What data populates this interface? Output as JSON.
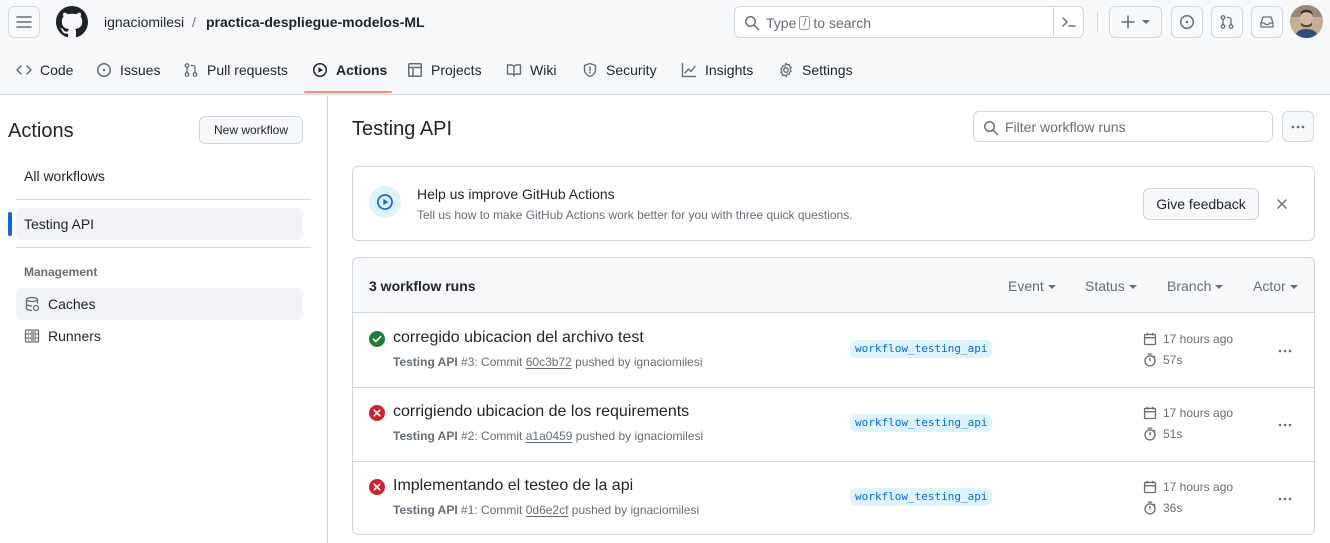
{
  "header": {
    "owner": "ignaciomilesi",
    "separator": "/",
    "repo": "practica-despliegue-modelos-ML",
    "search": {
      "prefix": "Type",
      "key": "/",
      "suffix": "to search"
    }
  },
  "repo_nav": {
    "tabs": [
      {
        "label": "Code",
        "icon": "code-icon"
      },
      {
        "label": "Issues",
        "icon": "issue-opened-icon"
      },
      {
        "label": "Pull requests",
        "icon": "git-pull-request-icon"
      },
      {
        "label": "Actions",
        "icon": "play-icon",
        "selected": true
      },
      {
        "label": "Projects",
        "icon": "table-icon"
      },
      {
        "label": "Wiki",
        "icon": "book-icon"
      },
      {
        "label": "Security",
        "icon": "shield-icon"
      },
      {
        "label": "Insights",
        "icon": "graph-icon"
      },
      {
        "label": "Settings",
        "icon": "gear-icon"
      }
    ]
  },
  "sidebar": {
    "title": "Actions",
    "new_workflow": "New workflow",
    "all_workflows": "All workflows",
    "workflows": [
      {
        "label": "Testing API",
        "active": true
      }
    ],
    "management_heading": "Management",
    "management": [
      {
        "label": "Caches",
        "icon": "database-icon"
      },
      {
        "label": "Runners",
        "icon": "server-icon"
      }
    ]
  },
  "main": {
    "title": "Testing API",
    "filter_placeholder": "Filter workflow runs",
    "banner": {
      "title": "Help us improve GitHub Actions",
      "subtitle": "Tell us how to make GitHub Actions work better for you with three quick questions.",
      "button": "Give feedback"
    },
    "runs_count": "3 workflow runs",
    "filters": [
      "Event",
      "Status",
      "Branch",
      "Actor"
    ],
    "runs": [
      {
        "status": "success",
        "title": "corregido ubicacion del archivo test",
        "workflow": "Testing API",
        "number": "#3",
        "commit_label": ": Commit",
        "sha": "60c3b72",
        "pushed_by": "pushed by ignaciomilesi",
        "branch": "workflow_testing_api",
        "when": "17 hours ago",
        "duration": "57s"
      },
      {
        "status": "failure",
        "title": "corrigiendo ubicacion de los requirements",
        "workflow": "Testing API",
        "number": "#2",
        "commit_label": ": Commit",
        "sha": "a1a0459",
        "pushed_by": "pushed by ignaciomilesi",
        "branch": "workflow_testing_api",
        "when": "17 hours ago",
        "duration": "51s"
      },
      {
        "status": "failure",
        "title": "Implementando el testeo de la api",
        "workflow": "Testing API",
        "number": "#1",
        "commit_label": ": Commit",
        "sha": "0d6e2cf",
        "pushed_by": "pushed by ignaciomilesi",
        "branch": "workflow_testing_api",
        "when": "17 hours ago",
        "duration": "36s"
      }
    ]
  },
  "colors": {
    "accent": "#0969da",
    "success": "#1a7f37",
    "failure": "#cf222e",
    "tab_underline": "#fd8c73"
  }
}
